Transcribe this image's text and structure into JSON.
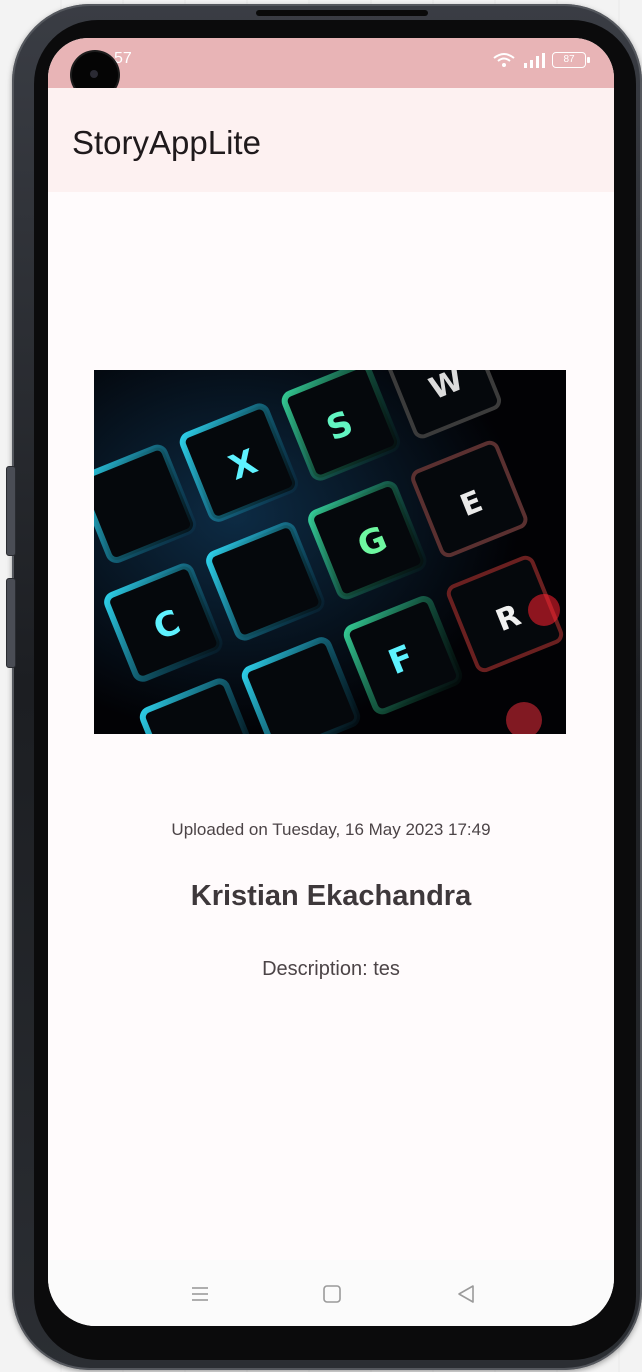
{
  "status_bar": {
    "time": "57",
    "battery": "87",
    "icons": [
      "wifi-icon",
      "signal-icon",
      "battery-icon"
    ],
    "color": "#e8b4b6"
  },
  "app_bar": {
    "title": "StoryAppLite",
    "color": "#fdf1f1"
  },
  "story": {
    "image_alt": "Backlit mechanical keyboard keys",
    "upload_date": "Uploaded on Tuesday, 16 May 2023 17:49",
    "author": "Kristian Ekachandra",
    "description": "Description: tes"
  },
  "nav_bar": {
    "buttons": [
      "menu-icon",
      "home-icon",
      "back-icon"
    ]
  },
  "colors": {
    "screen_bg": "#fffbfc",
    "text_primary": "#3e383b",
    "text_secondary": "#4c4447"
  }
}
